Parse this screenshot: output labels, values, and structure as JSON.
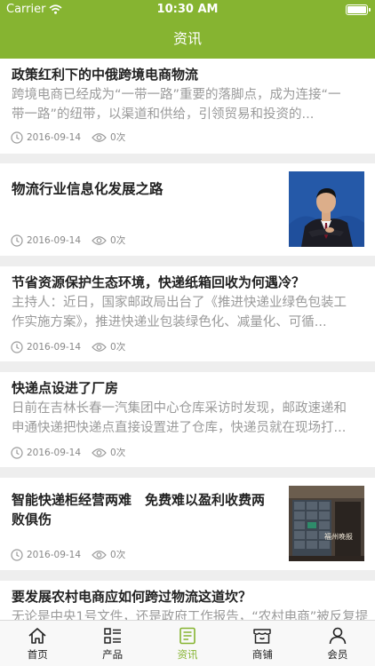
{
  "status": {
    "carrier": "Carrier",
    "time": "10:30 AM"
  },
  "nav": {
    "title": "资讯"
  },
  "colors": {
    "brand": "#86b431"
  },
  "articles": [
    {
      "title": "政策红利下的中俄跨境电商物流",
      "summary": "跨境电商已经成为“一带一路”重要的落脚点，成为连接“一带一路”的纽带，以渠道和供给，引领贸易和投资的...",
      "date": "2016-09-14",
      "views": "0次"
    },
    {
      "title": "物流行业信息化发展之路",
      "date": "2016-09-14",
      "views": "0次",
      "image": "businessman-photo"
    },
    {
      "title": "节省资源保护生态环境，快递纸箱回收为何遇冷？",
      "summary": "主持人：近日，国家邮政局出台了《推进快递业绿色包装工作实施方案》，推进快递业包装绿色化、减量化、可循...",
      "date": "2016-09-14",
      "views": "0次"
    },
    {
      "title": "快递点设进了厂房",
      "summary": "日前在吉林长春一汽集团中心仓库采访时发现，邮政速递和申通快递把快递点直接设置进了仓库，快递员就在现场打...",
      "date": "2016-09-14",
      "views": "0次"
    },
    {
      "title": "智能快递柜经营两难　免费难以盈利收费两败俱伤",
      "date": "2016-09-14",
      "views": "0次",
      "image": "parcel-locker-photo",
      "image_caption": "福州晚报"
    },
    {
      "title": "要发展农村电商应如何跨过物流这道坎？",
      "summary": "无论是中央1号文件，还是政府工作报告，“农村电商”被反复提"
    }
  ],
  "tabs": [
    {
      "label": "首页",
      "icon": "home-icon"
    },
    {
      "label": "产品",
      "icon": "grid-list-icon"
    },
    {
      "label": "资讯",
      "icon": "news-icon",
      "active": true
    },
    {
      "label": "商铺",
      "icon": "store-icon"
    },
    {
      "label": "会员",
      "icon": "user-icon"
    }
  ]
}
